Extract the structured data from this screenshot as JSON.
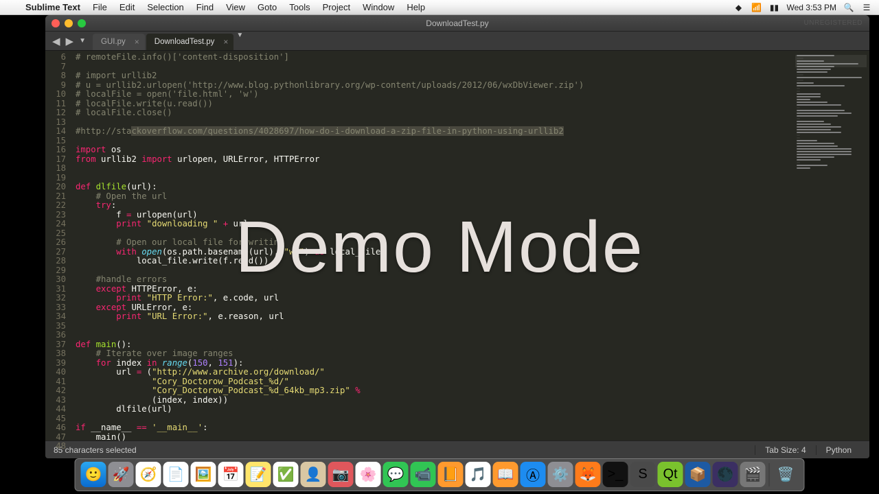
{
  "menubar": {
    "app": "Sublime Text",
    "items": [
      "File",
      "Edit",
      "Selection",
      "Find",
      "View",
      "Goto",
      "Tools",
      "Project",
      "Window",
      "Help"
    ],
    "clock": "Wed 3:53 PM"
  },
  "window": {
    "title": "DownloadTest.py",
    "unregistered": "UNREGISTERED"
  },
  "tabs": [
    {
      "label": "GUI.py",
      "active": false
    },
    {
      "label": "DownloadTest.py",
      "active": true
    }
  ],
  "gutter_start": 6,
  "gutter_end": 48,
  "code_lines": [
    {
      "n": 6,
      "html": "<span class='c'># remoteFile.info()['content-disposition']</span>"
    },
    {
      "n": 7,
      "html": ""
    },
    {
      "n": 8,
      "html": "<span class='c'># import urllib2</span>"
    },
    {
      "n": 9,
      "html": "<span class='c'># u = urllib2.urlopen('http://www.blog.pythonlibrary.org/wp-content/uploads/2012/06/wxDbViewer.zip')</span>"
    },
    {
      "n": 10,
      "html": "<span class='c'># localFile = open('file.html', 'w')</span>"
    },
    {
      "n": 11,
      "html": "<span class='c'># localFile.write(u.read())</span>"
    },
    {
      "n": 12,
      "html": "<span class='c'># localFile.close()</span>"
    },
    {
      "n": 13,
      "html": ""
    },
    {
      "n": 14,
      "html": "<span class='c'>#http://sta<span class='sel'>ckoverflow.com/questions/4028697/how-do-i-download-a-zip-file-in-python-using-urllib2</span></span>"
    },
    {
      "n": 15,
      "html": ""
    },
    {
      "n": 16,
      "html": "<span class='k'>import</span> os"
    },
    {
      "n": 17,
      "html": "<span class='k'>from</span> urllib2 <span class='k'>import</span> urlopen, URLError, HTTPError"
    },
    {
      "n": 18,
      "html": ""
    },
    {
      "n": 19,
      "html": ""
    },
    {
      "n": 20,
      "html": "<span class='k'>def</span> <span class='fn'>dlfile</span>(url):"
    },
    {
      "n": 21,
      "html": "    <span class='c'># Open the url</span>"
    },
    {
      "n": 22,
      "html": "    <span class='k'>try</span>:"
    },
    {
      "n": 23,
      "html": "        f <span class='k'>=</span> urlopen(url)"
    },
    {
      "n": 24,
      "html": "        <span class='k'>print</span> <span class='s'>\"downloading \"</span> <span class='k'>+</span> url"
    },
    {
      "n": 25,
      "html": ""
    },
    {
      "n": 26,
      "html": "        <span class='c'># Open our local file for writing</span>"
    },
    {
      "n": 27,
      "html": "        <span class='k'>with</span> <span class='bi'>open</span>(os.path.basename(url), <span class='s'>\"wb\"</span>) <span class='k'>as</span> local_file:"
    },
    {
      "n": 28,
      "html": "            local_file.write(f.read())"
    },
    {
      "n": 29,
      "html": ""
    },
    {
      "n": 30,
      "html": "    <span class='c'>#handle errors</span>"
    },
    {
      "n": 31,
      "html": "    <span class='k'>except</span> HTTPError, e:"
    },
    {
      "n": 32,
      "html": "        <span class='k'>print</span> <span class='s'>\"HTTP Error:\"</span>, e.code, url"
    },
    {
      "n": 33,
      "html": "    <span class='k'>except</span> URLError, e:"
    },
    {
      "n": 34,
      "html": "        <span class='k'>print</span> <span class='s'>\"URL Error:\"</span>, e.reason, url"
    },
    {
      "n": 35,
      "html": ""
    },
    {
      "n": 36,
      "html": ""
    },
    {
      "n": 37,
      "html": "<span class='k'>def</span> <span class='fn'>main</span>():"
    },
    {
      "n": 38,
      "html": "    <span class='c'># Iterate over image ranges</span>"
    },
    {
      "n": 39,
      "html": "    <span class='k'>for</span> index <span class='k'>in</span> <span class='bi'>range</span>(<span class='n'>150</span>, <span class='n'>151</span>):"
    },
    {
      "n": 40,
      "html": "        url <span class='k'>=</span> (<span class='s'>\"http://www.archive.org/download/\"</span>"
    },
    {
      "n": 41,
      "html": "               <span class='s'>\"Cory_Doctorow_Podcast_%d/\"</span>"
    },
    {
      "n": 42,
      "html": "               <span class='s'>\"Cory_Doctorow_Podcast_%d_64kb_mp3.zip\"</span> <span class='k'>%</span>"
    },
    {
      "n": 43,
      "html": "               (index, index))"
    },
    {
      "n": 44,
      "html": "        dlfile(url)"
    },
    {
      "n": 45,
      "html": ""
    },
    {
      "n": 46,
      "html": "<span class='k'>if</span> __name__ <span class='k'>==</span> <span class='s'>'__main__'</span>:"
    },
    {
      "n": 47,
      "html": "    main()"
    },
    {
      "n": 48,
      "html": ""
    }
  ],
  "statusbar": {
    "left": "85 characters selected",
    "tabsize": "Tab Size: 4",
    "lang": "Python"
  },
  "overlay": "Demo Mode",
  "dock_icons": [
    {
      "name": "finder",
      "bg": "linear-gradient(#2aa7f0,#0a6bcf)",
      "glyph": "🙂"
    },
    {
      "name": "launchpad",
      "bg": "#8e8e93",
      "glyph": "🚀"
    },
    {
      "name": "safari",
      "bg": "#fff",
      "glyph": "🧭"
    },
    {
      "name": "textedit",
      "bg": "#fff",
      "glyph": "📄"
    },
    {
      "name": "preview",
      "bg": "#fff",
      "glyph": "🖼️"
    },
    {
      "name": "calendar",
      "bg": "#fff",
      "glyph": "📅"
    },
    {
      "name": "notes",
      "bg": "#ffe56b",
      "glyph": "📝"
    },
    {
      "name": "reminders",
      "bg": "#fff",
      "glyph": "✅"
    },
    {
      "name": "contacts",
      "bg": "#d9c7a3",
      "glyph": "👤"
    },
    {
      "name": "photobooth",
      "bg": "#e0575c",
      "glyph": "📷"
    },
    {
      "name": "photos",
      "bg": "#fff",
      "glyph": "🌸"
    },
    {
      "name": "messages",
      "bg": "#31c554",
      "glyph": "💬"
    },
    {
      "name": "facetime",
      "bg": "#31c554",
      "glyph": "📹"
    },
    {
      "name": "pages",
      "bg": "#ff9a2e",
      "glyph": "📙"
    },
    {
      "name": "itunes",
      "bg": "#fff",
      "glyph": "🎵"
    },
    {
      "name": "ibooks",
      "bg": "#ff9a2e",
      "glyph": "📖"
    },
    {
      "name": "appstore",
      "bg": "#1d8cf0",
      "glyph": "Ⓐ"
    },
    {
      "name": "settings",
      "bg": "#8e8e93",
      "glyph": "⚙️"
    },
    {
      "name": "firefox",
      "bg": "#ff7b1a",
      "glyph": "🦊"
    },
    {
      "name": "terminal",
      "bg": "#111",
      "glyph": ">_"
    },
    {
      "name": "sublime",
      "bg": "#4a4a4a",
      "glyph": "S"
    },
    {
      "name": "qt",
      "bg": "#7ac22d",
      "glyph": "Qt"
    },
    {
      "name": "virtualbox",
      "bg": "#1d5aa3",
      "glyph": "📦"
    },
    {
      "name": "eclipse",
      "bg": "#3b2f62",
      "glyph": "🌑"
    },
    {
      "name": "other",
      "bg": "#777",
      "glyph": "🎬"
    }
  ],
  "dock_trash": {
    "name": "trash",
    "glyph": "🗑️"
  }
}
